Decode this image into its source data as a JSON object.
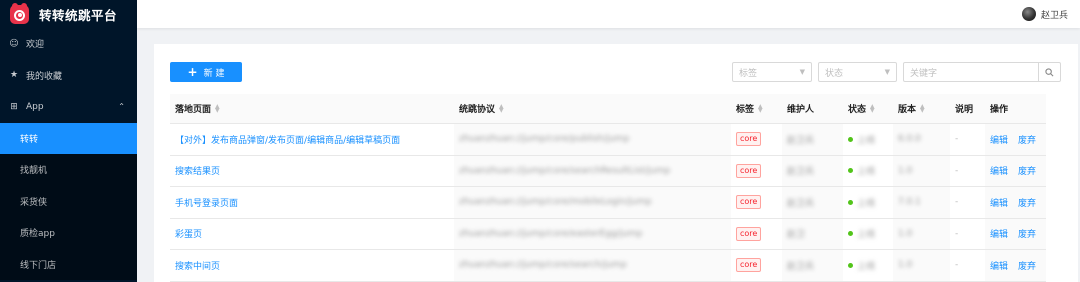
{
  "app": {
    "title": "转转统跳平台"
  },
  "header": {
    "username": "赵卫兵"
  },
  "sidebar": {
    "welcome": "欢迎",
    "favorites": "我的收藏",
    "app_group": "App",
    "apps": [
      "转转",
      "找靓机",
      "采货侠",
      "质检app",
      "线下门店"
    ]
  },
  "toolbar": {
    "new_label": "新 建",
    "tag_placeholder": "标签",
    "status_placeholder": "状态",
    "keyword_placeholder": "关键字"
  },
  "table": {
    "columns": [
      "落地页面",
      "统跳协议",
      "标签",
      "维护人",
      "状态",
      "版本",
      "说明",
      "操作"
    ],
    "rows": [
      {
        "page": "【对外】发布商品弹窗/发布页面/编辑商品/编辑草稿页面",
        "protocol": "zhuanzhuan://jump/core/publish/jump",
        "tag": "core",
        "maintainer": "赵卫兵",
        "status": "上线",
        "version": "6.0.0",
        "desc": "-",
        "edit": "编辑",
        "discard": "废弃"
      },
      {
        "page": "搜索结果页",
        "protocol": "zhuanzhuan://jump/core/searchResultList/jump",
        "tag": "core",
        "maintainer": "赵卫兵",
        "status": "上线",
        "version": "1.0",
        "desc": "-",
        "edit": "编辑",
        "discard": "废弃"
      },
      {
        "page": "手机号登录页面",
        "protocol": "zhuanzhuan://jump/core/mobileLogin/jump",
        "tag": "core",
        "maintainer": "赵卫兵",
        "status": "上线",
        "version": "7.0.1",
        "desc": "-",
        "edit": "编辑",
        "discard": "废弃"
      },
      {
        "page": "彩蛋页",
        "protocol": "zhuanzhuan://jump/core/easterEgg/jump",
        "tag": "core",
        "maintainer": "赵卫",
        "status": "上线",
        "version": "1.0",
        "desc": "-",
        "edit": "编辑",
        "discard": "废弃"
      },
      {
        "page": "搜索中间页",
        "protocol": "zhuanzhuan://jump/core/search/jump",
        "tag": "core",
        "maintainer": "赵卫兵",
        "status": "上线",
        "version": "1.0",
        "desc": "-",
        "edit": "编辑",
        "discard": "废弃"
      }
    ]
  },
  "colors": {
    "primary": "#1890ff",
    "sidebar_bg": "#001529",
    "logo_red": "#e8334a",
    "status_green": "#52c41a",
    "tag_red": "#f5222d"
  }
}
